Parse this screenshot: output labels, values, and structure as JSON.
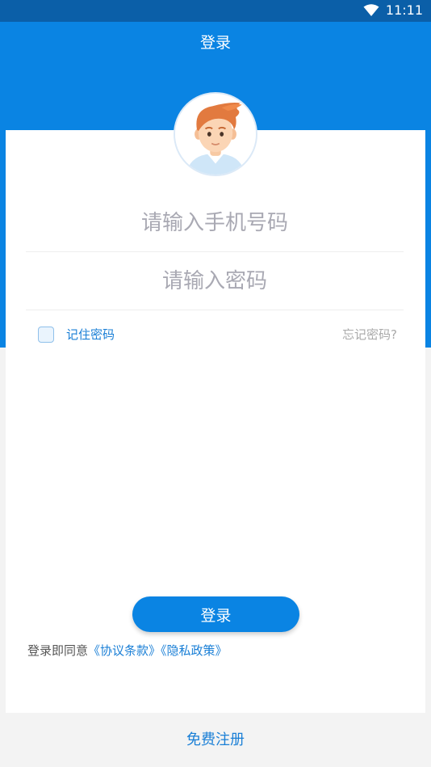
{
  "status_bar": {
    "time": "11:11",
    "wifi_icon": "wifi-icon"
  },
  "header": {
    "title": "登录"
  },
  "avatar": {
    "icon": "avatar-icon"
  },
  "form": {
    "phone_placeholder": "请输入手机号码",
    "phone_value": "",
    "password_placeholder": "请输入密码",
    "password_value": "",
    "remember_label": "记住密码",
    "remember_checked": false,
    "forgot_label": "忘记密码?"
  },
  "login_button": {
    "label": "登录"
  },
  "agreement": {
    "prefix": "登录即同意",
    "terms_link": "《协议条款》",
    "privacy_link": "《隐私政策》"
  },
  "footer": {
    "register_label": "免费注册"
  },
  "colors": {
    "primary": "#0a84e3",
    "status_bar": "#0b5fa8",
    "link": "#1a7fd6",
    "placeholder": "#a9a9b3"
  }
}
